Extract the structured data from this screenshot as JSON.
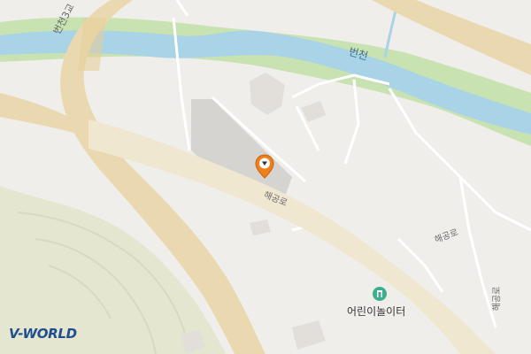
{
  "map": {
    "river_label": "번천",
    "bridge_label": "번천3교",
    "road_label_main": "해공로",
    "road_label_east": "해공로",
    "road_label_vertical": "해공로",
    "poi_label": "어린이놀이터",
    "provider_logo": "V-WORLD",
    "colors": {
      "background": "#efeeea",
      "river": "#a9d3e6",
      "riverbank": "#c8e2b2",
      "main_road": "#ead9b0",
      "minor_road": "#efe9d6",
      "building": "#dcdad6",
      "hill": "#e4e6cf",
      "marker": "#ef7f1a",
      "poi_icon": "#3fae8c"
    },
    "icons": {
      "marker": "location-pin-icon",
      "poi": "playground-icon"
    }
  }
}
